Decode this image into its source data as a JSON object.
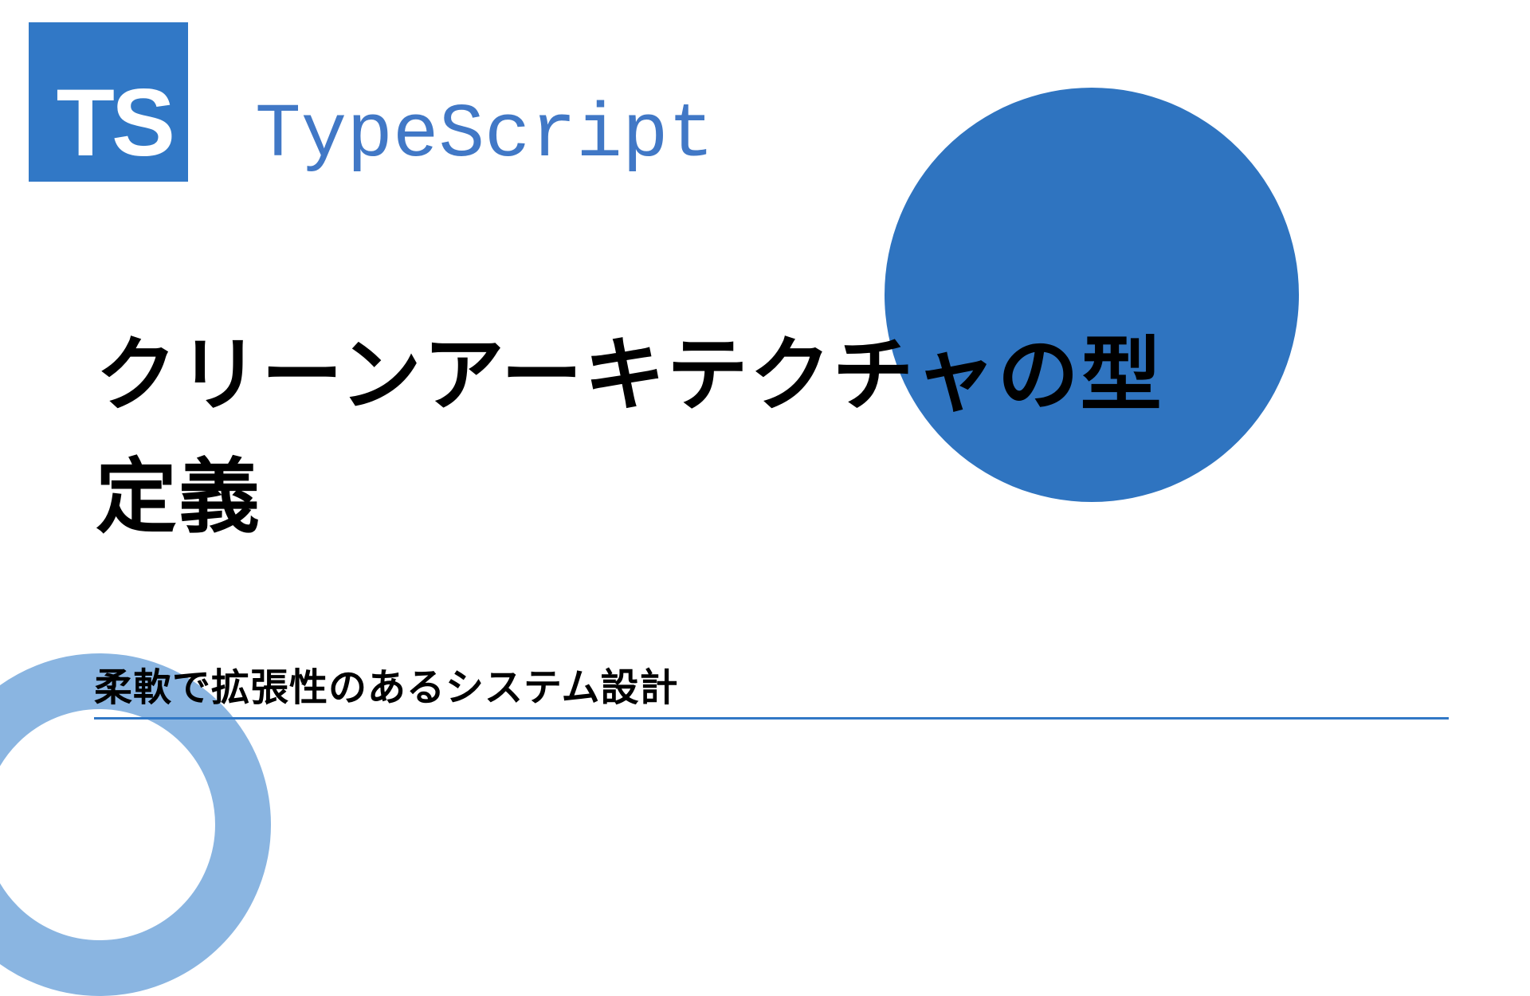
{
  "logo": {
    "abbreviation": "TS",
    "brand_name": "TypeScript"
  },
  "title": "クリーンアーキテクチャの型定義",
  "subtitle": "柔軟で拡張性のあるシステム設計",
  "colors": {
    "primary": "#3178c6",
    "accent": "#2f74c0",
    "ring": "#8ab5e1"
  }
}
